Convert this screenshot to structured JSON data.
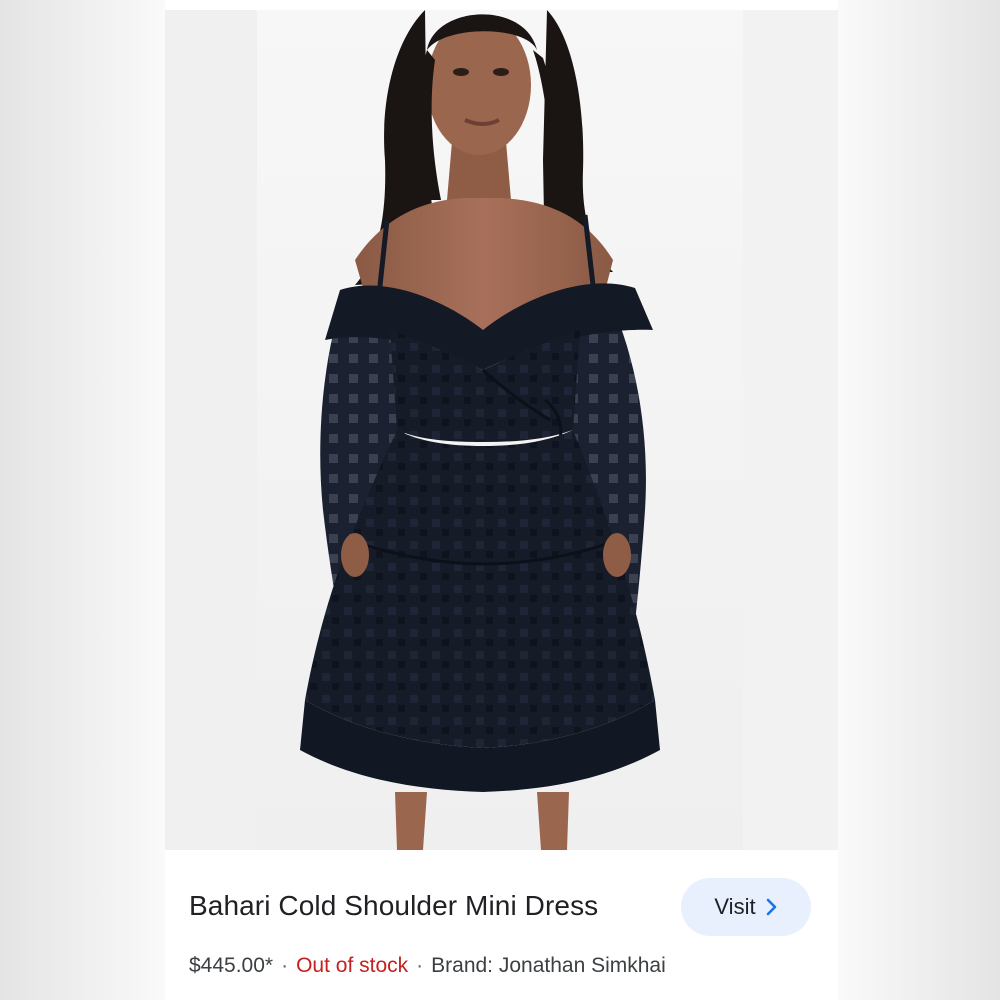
{
  "product": {
    "title": "Bahari Cold Shoulder Mini Dress",
    "price": "$445.00*",
    "separator": "·",
    "stock_status": "Out of stock",
    "brand": "Brand: Jonathan Simkhai",
    "visit_label": "Visit",
    "image_alt": "Model wearing a black off-shoulder mini dress"
  },
  "colors": {
    "stock_status": "#c5221f",
    "visit_bg": "#e8f0fe",
    "chevron": "#1a73e8",
    "dress": "#151a26"
  },
  "icons": {
    "visit": "chevron-right-icon"
  }
}
